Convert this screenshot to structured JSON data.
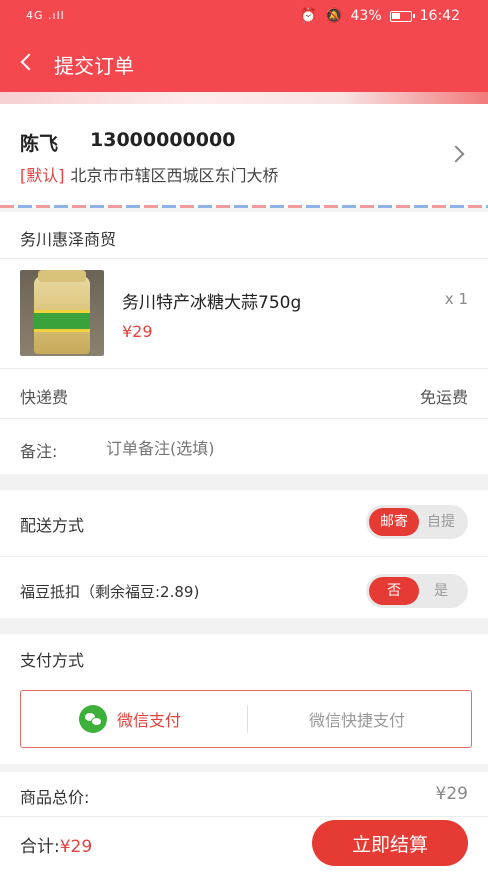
{
  "status": {
    "left": "4G .ıll ",
    "battery": "43%",
    "time": "16:42"
  },
  "header": {
    "title": "提交订单"
  },
  "address": {
    "name": "陈飞",
    "phone": "13000000000",
    "default_tag": "[默认]",
    "detail": "北京市市辖区西城区东门大桥"
  },
  "shop": {
    "name": "务川惠泽商贸",
    "product": {
      "name": "务川特产冰糖大蒜750g",
      "price": "¥29",
      "qty": "x 1"
    },
    "shipping_label": "快递费",
    "shipping_value": "免运费",
    "remark_label": "备注:",
    "remark_placeholder": "订单备注(选填)"
  },
  "options": {
    "delivery": {
      "label": "配送方式",
      "opt_on": "邮寄",
      "opt_off": "自提"
    },
    "fudou": {
      "label": "福豆抵扣（剩余福豆:2.89)",
      "opt_on": "否",
      "opt_off": "是"
    }
  },
  "payment": {
    "title": "支付方式",
    "wechat": "微信支付",
    "wechat_quick": "微信快捷支付"
  },
  "summary": {
    "total_label": "商品总价:",
    "total_value": "¥29",
    "sum_label": "合计:",
    "sum_value": "¥29",
    "checkout": "立即结算"
  },
  "colors": {
    "brand": "#f5474e",
    "accent": "#e63b34",
    "wechat": "#3db03a"
  }
}
